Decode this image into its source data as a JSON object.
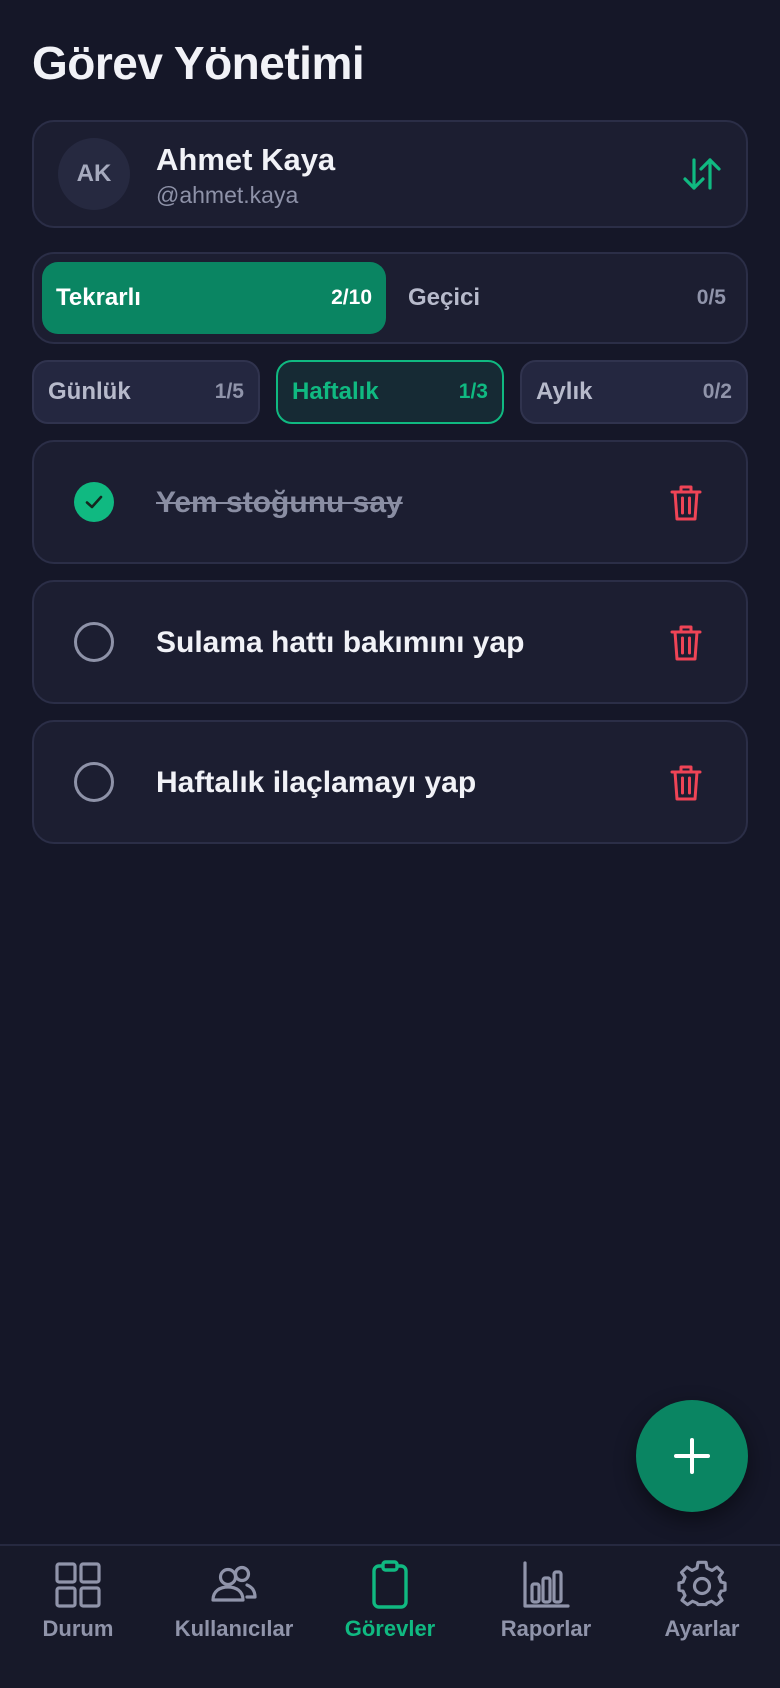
{
  "header": {
    "title": "Görev Yönetimi"
  },
  "user": {
    "initials": "AK",
    "name": "Ahmet Kaya",
    "handle": "@ahmet.kaya",
    "swap_icon": "swap-vertical-icon"
  },
  "type_tabs": [
    {
      "label": "Tekrarlı",
      "count": "2/10",
      "active": true
    },
    {
      "label": "Geçici",
      "count": "0/5",
      "active": false
    }
  ],
  "period_tabs": [
    {
      "label": "Günlük",
      "count": "1/5",
      "active": false
    },
    {
      "label": "Haftalık",
      "count": "1/3",
      "active": true
    },
    {
      "label": "Aylık",
      "count": "0/2",
      "active": false
    }
  ],
  "tasks": [
    {
      "text": "Yem stoğunu say",
      "done": true
    },
    {
      "text": "Sulama hattı bakımını yap",
      "done": false
    },
    {
      "text": "Haftalık ilaçlamayı yap",
      "done": false
    }
  ],
  "fab": {
    "icon": "plus-icon"
  },
  "nav": [
    {
      "label": "Durum",
      "icon": "grid-icon",
      "active": false
    },
    {
      "label": "Kullanıcılar",
      "icon": "users-icon",
      "active": false
    },
    {
      "label": "Görevler",
      "icon": "clipboard-icon",
      "active": true
    },
    {
      "label": "Raporlar",
      "icon": "bar-chart-icon",
      "active": false
    },
    {
      "label": "Ayarlar",
      "icon": "gear-icon",
      "active": false
    }
  ],
  "colors": {
    "background": "#151728",
    "card": "#1C1E31",
    "accent": "#10B981",
    "accent_dark": "#0A8562",
    "danger": "#EF4456",
    "muted": "#9094AA"
  }
}
